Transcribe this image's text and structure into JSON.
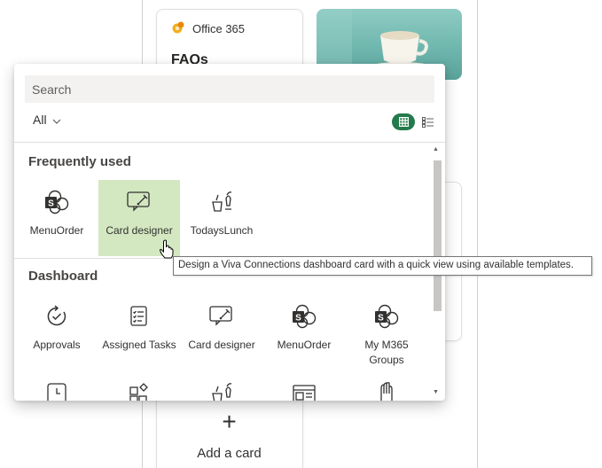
{
  "background": {
    "office_card": {
      "source": "Office 365",
      "title": "FAQs"
    },
    "add_card": {
      "plus": "+",
      "label": "Add a card"
    }
  },
  "panel": {
    "search": {
      "placeholder": "Search"
    },
    "filter": {
      "label": "All",
      "icon": "chevron-down-icon"
    },
    "view_toggle": {
      "grid_icon": "grid-view-icon",
      "list_icon": "list-view-icon",
      "active": "grid",
      "active_color": "#237b4b"
    },
    "sections": [
      {
        "title": "Frequently used",
        "items": [
          {
            "label": "MenuOrder",
            "icon": "sharepoint-icon"
          },
          {
            "label": "Card designer",
            "icon": "card-designer-icon",
            "selected": true
          },
          {
            "label": "TodaysLunch",
            "icon": "lunch-icon"
          }
        ]
      },
      {
        "title": "Dashboard",
        "items": [
          {
            "label": "Approvals",
            "icon": "approvals-icon"
          },
          {
            "label": "Assigned Tasks",
            "icon": "tasks-icon"
          },
          {
            "label": "Card designer",
            "icon": "card-designer-icon"
          },
          {
            "label": "MenuOrder",
            "icon": "sharepoint-icon"
          },
          {
            "label": "My M365 Groups",
            "icon": "sharepoint-icon"
          }
        ]
      }
    ],
    "selected_color": "#d3e8c1"
  },
  "tooltip": {
    "text": "Design a Viva Connections dashboard card with a quick view using available templates."
  }
}
